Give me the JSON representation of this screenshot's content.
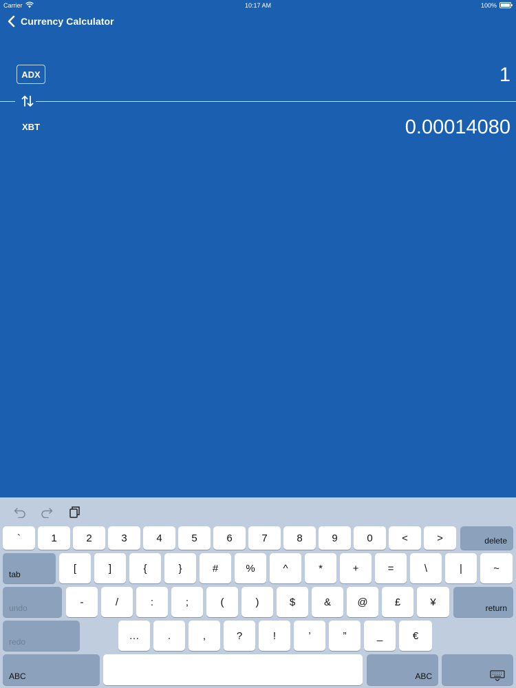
{
  "status_bar": {
    "carrier": "Carrier",
    "time": "10:17 AM",
    "battery": "100%"
  },
  "nav": {
    "back_label": "Currency Calculator"
  },
  "converter": {
    "from_code": "ADX",
    "from_value": "1",
    "to_code": "XBT",
    "to_value": "0.00014080"
  },
  "keyboard": {
    "row1": [
      "`",
      "1",
      "2",
      "3",
      "4",
      "5",
      "6",
      "7",
      "8",
      "9",
      "0",
      "<",
      ">"
    ],
    "delete": "delete",
    "tab": "tab",
    "row2": [
      "[",
      "]",
      "{",
      "}",
      "#",
      "%",
      "^",
      "*",
      "+",
      "=",
      "\\",
      "|",
      "~"
    ],
    "undo": "undo",
    "row3": [
      "-",
      "/",
      ":",
      ";",
      "(",
      ")",
      "$",
      "&",
      "@",
      "£",
      "¥"
    ],
    "return": "return",
    "redo": "redo",
    "row4": [
      "…",
      ".",
      ",",
      "?",
      "!",
      "’",
      "”",
      "_",
      "€"
    ],
    "abc_left": "ABC",
    "abc_right": "ABC"
  },
  "colors": {
    "background": "#1b5fb0",
    "keyboard": "#bfcddf",
    "key": "#ffffff",
    "key_dark": "#8ba1bc"
  }
}
